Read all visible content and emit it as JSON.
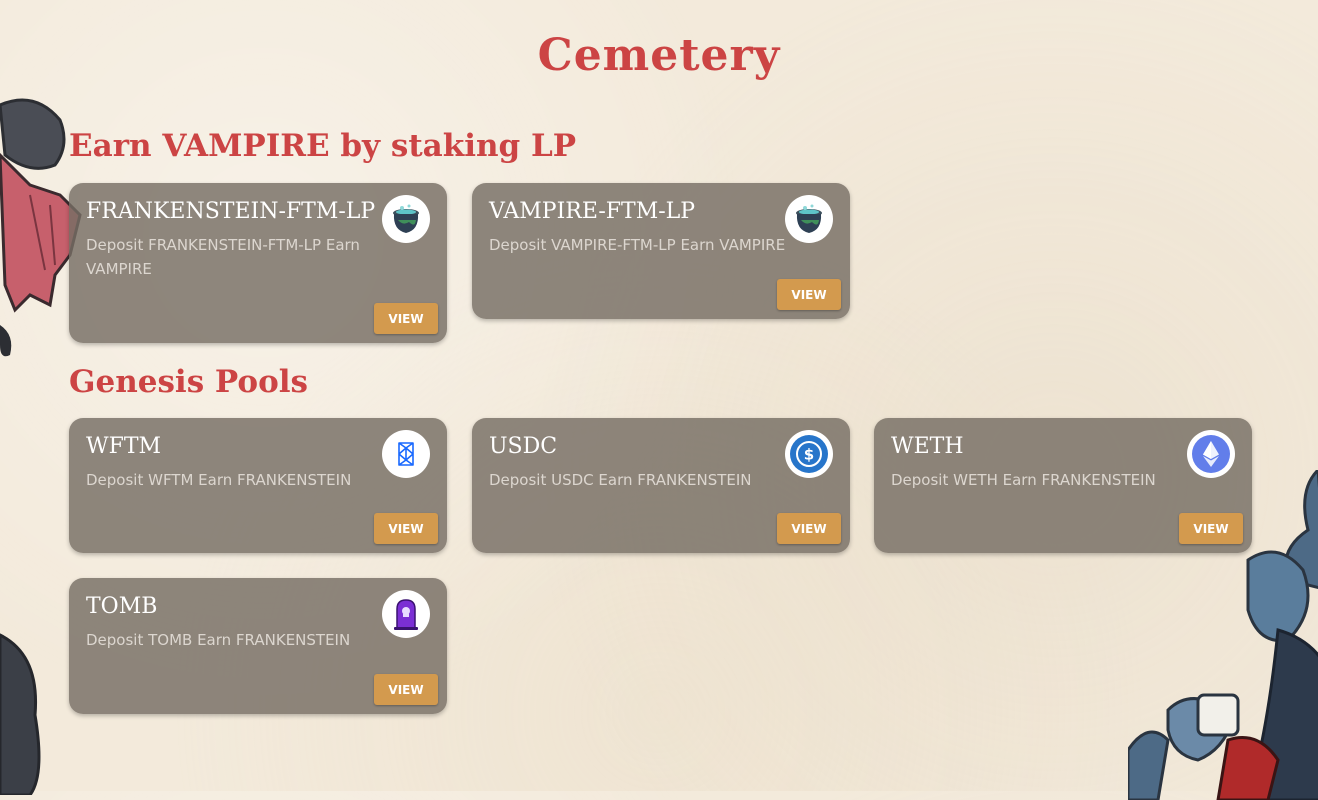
{
  "page": {
    "title": "Cemetery"
  },
  "sections": [
    {
      "title": "Earn VAMPIRE by staking LP",
      "pools": [
        {
          "name": "FRANKENSTEIN-FTM-LP",
          "description": "Deposit FRANKENSTEIN-FTM-LP Earn VAMPIRE",
          "icon": "cauldron-icon",
          "button": "VIEW"
        },
        {
          "name": "VAMPIRE-FTM-LP",
          "description": "Deposit VAMPIRE-FTM-LP Earn VAMPIRE",
          "icon": "cauldron-icon",
          "button": "VIEW"
        }
      ]
    },
    {
      "title": "Genesis Pools",
      "pools": [
        {
          "name": "WFTM",
          "description": "Deposit WFTM Earn FRANKENSTEIN",
          "icon": "fantom-icon",
          "button": "VIEW"
        },
        {
          "name": "USDC",
          "description": "Deposit USDC Earn FRANKENSTEIN",
          "icon": "usdc-icon",
          "button": "VIEW"
        },
        {
          "name": "WETH",
          "description": "Deposit WETH Earn FRANKENSTEIN",
          "icon": "ethereum-icon",
          "button": "VIEW"
        },
        {
          "name": "TOMB",
          "description": "Deposit TOMB Earn FRANKENSTEIN",
          "icon": "tombstone-icon",
          "button": "VIEW"
        }
      ]
    }
  ],
  "colors": {
    "background": "#f3eadb",
    "heading": "#cc4444",
    "card": "#766e64",
    "button": "#d39a4e",
    "fantom": "#1969ff",
    "usdc": "#2775ca",
    "ethereum": "#627eea",
    "tomb": "#7b2fd4"
  }
}
